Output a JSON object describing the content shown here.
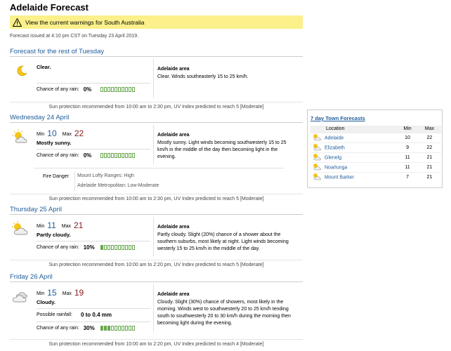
{
  "page_title": "Adelaide Forecast",
  "warning": "View the current warnings for South Australia",
  "issued": "Forecast issued at 4:10 pm CST on Tuesday 23 April 2019.",
  "labels": {
    "min": "Min",
    "max": "Max",
    "chance_rain": "Chance of any rain:",
    "possible_rainfall": "Possible rainfall:",
    "fire_danger": "Fire Danger"
  },
  "days": [
    {
      "heading": "Forecast for the rest of Tuesday",
      "icon": "moon-icon",
      "precis": "Clear.",
      "rain_chance": "0%",
      "rain_fraction": 0,
      "area_name": "Adelaide area",
      "area_text": "Clear. Winds southeasterly 15 to 25 km/h.",
      "uv": "Sun protection recommended from 10:00 am to 2:30 pm, UV Index predicted to reach 5 [Moderate]"
    },
    {
      "heading": "Wednesday 24 April",
      "icon": "sunny-cloud-icon",
      "min": "10",
      "max": "22",
      "precis": "Mostly sunny.",
      "rain_chance": "0%",
      "rain_fraction": 0,
      "area_name": "Adelaide area",
      "area_text": "Mostly sunny. Light winds becoming southwesterly 15 to 25 km/h in the middle of the day then becoming light in the evening.",
      "fire": [
        "Mount Lofty Ranges: High",
        "Adelaide Metropolitan: Low-Moderate"
      ],
      "uv": "Sun protection recommended from 10:00 am to 2:30 pm, UV Index predicted to reach 5 [Moderate]"
    },
    {
      "heading": "Thursday 25 April",
      "icon": "partly-cloudy-icon",
      "min": "11",
      "max": "21",
      "precis": "Partly cloudy.",
      "rain_chance": "10%",
      "rain_fraction": 0.1,
      "area_name": "Adelaide area",
      "area_text": "Partly cloudy. Slight (20%) chance of a shower about the southern suburbs, most likely at night. Light winds becoming westerly 15 to 25 km/h in the middle of the day.",
      "uv": "Sun protection recommended from 10:00 am to 2:20 pm, UV Index predicted to reach 5 [Moderate]"
    },
    {
      "heading": "Friday 26 April",
      "icon": "cloudy-icon",
      "min": "15",
      "max": "19",
      "precis": "Cloudy.",
      "rainfall": "0 to 0.4 mm",
      "rain_chance": "30%",
      "rain_fraction": 0.3,
      "area_name": "Adelaide area",
      "area_text": "Cloudy. Slight (30%) chance of showers, most likely in the morning. Winds west to southwesterly 20 to 25 km/h tending south to southwesterly 20 to 30 km/h during the morning then becoming light during the evening.",
      "uv": "Sun protection recommended from 10:00 am to 2:20 pm, UV Index predicted to reach 4 [Moderate]"
    }
  ],
  "towns": {
    "heading": "7 day Town Forecasts",
    "headers": [
      "Location",
      "Min",
      "Max"
    ],
    "rows": [
      {
        "name": "Adelaide",
        "min": "10",
        "max": "22"
      },
      {
        "name": "Elizabeth",
        "min": "9",
        "max": "22"
      },
      {
        "name": "Glenelg",
        "min": "11",
        "max": "21"
      },
      {
        "name": "Noarlunga",
        "min": "11",
        "max": "21"
      },
      {
        "name": "Mount Barker",
        "min": "7",
        "max": "21"
      }
    ]
  }
}
